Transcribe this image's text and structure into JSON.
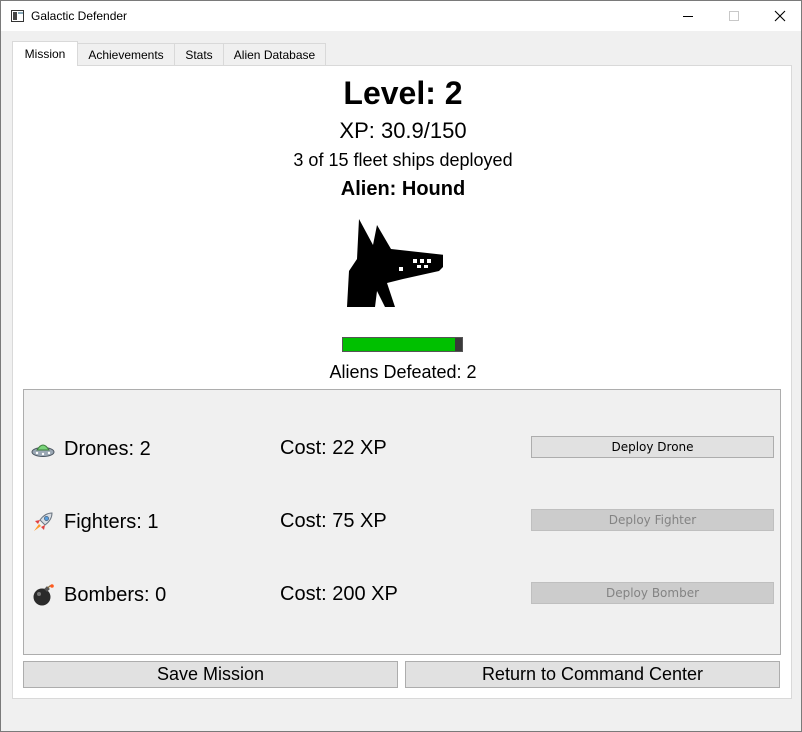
{
  "window": {
    "title": "Galactic Defender"
  },
  "tabs": [
    {
      "label": "Mission",
      "active": true
    },
    {
      "label": "Achievements",
      "active": false
    },
    {
      "label": "Stats",
      "active": false
    },
    {
      "label": "Alien Database",
      "active": false
    }
  ],
  "mission": {
    "level_text": "Level: 2",
    "xp_text": "XP: 30.9/150",
    "fleet_text": "3 of 15 fleet ships deployed",
    "alien_text": "Alien: Hound",
    "alien_health_fraction": 0.94,
    "defeated_text": "Aliens Defeated: 2"
  },
  "shop": {
    "rows": [
      {
        "icon": "ufo-icon",
        "count_text": "Drones: 2",
        "cost_text": "Cost: 22 XP",
        "button_label": "Deploy Drone",
        "enabled": true
      },
      {
        "icon": "rocket-icon",
        "count_text": "Fighters: 1",
        "cost_text": "Cost: 75 XP",
        "button_label": "Deploy Fighter",
        "enabled": false
      },
      {
        "icon": "bomb-icon",
        "count_text": "Bombers: 0",
        "cost_text": "Cost: 200 XP",
        "button_label": "Deploy Bomber",
        "enabled": false
      }
    ]
  },
  "footer": {
    "save_label": "Save Mission",
    "return_label": "Return to Command Center"
  },
  "colors": {
    "health_fill": "#00c000",
    "health_empty": "#3a3a3a"
  }
}
